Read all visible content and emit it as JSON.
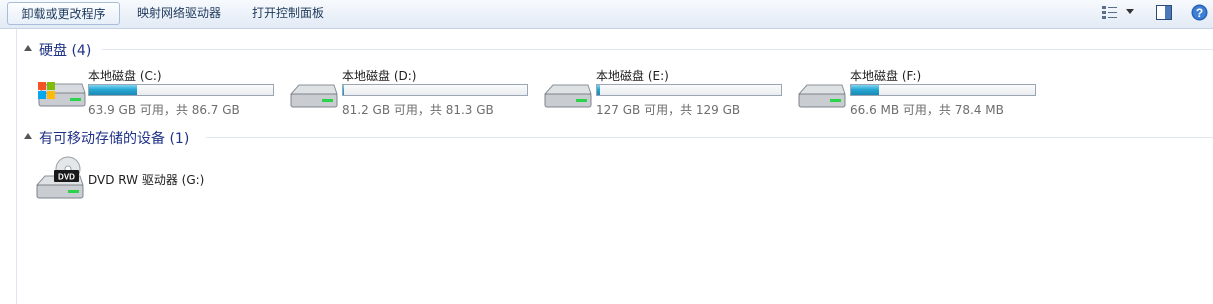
{
  "toolbar": {
    "uninstall_label": "卸载或更改程序",
    "map_drive_label": "映射网络驱动器",
    "control_panel_label": "打开控制面板"
  },
  "groups": {
    "hard_disks": {
      "title": "硬盘 (4)"
    },
    "removable": {
      "title": "有可移动存储的设备 (1)"
    }
  },
  "drives": [
    {
      "name": "本地磁盘 (C:)",
      "space": "63.9 GB 可用，共 86.7 GB",
      "used_fraction": 0.263,
      "icon": "windows-system-drive-icon"
    },
    {
      "name": "本地磁盘 (D:)",
      "space": "81.2 GB 可用，共 81.3 GB",
      "used_fraction": 0.001,
      "icon": "hard-drive-icon"
    },
    {
      "name": "本地磁盘 (E:)",
      "space": "127 GB 可用，共 129 GB",
      "used_fraction": 0.016,
      "icon": "hard-drive-icon"
    },
    {
      "name": "本地磁盘 (F:)",
      "space": "66.6 MB 可用，共 78.4 MB",
      "used_fraction": 0.151,
      "icon": "hard-drive-icon"
    }
  ],
  "removable_drives": [
    {
      "name": "DVD RW 驱动器 (G:)",
      "icon": "dvd-drive-icon",
      "disc_label": "DVD"
    }
  ],
  "colors": {
    "bar_fill": "#27a7d4",
    "group_title": "#1e3287",
    "toolbar_text": "#1e395b"
  }
}
